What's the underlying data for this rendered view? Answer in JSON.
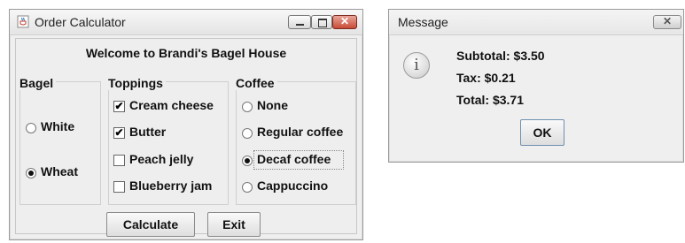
{
  "order_window": {
    "title": "Order Calculator",
    "welcome": "Welcome to Brandi's Bagel House",
    "bagel": {
      "label": "Bagel",
      "options": [
        {
          "label": "White",
          "selected": false
        },
        {
          "label": "Wheat",
          "selected": true
        }
      ]
    },
    "toppings": {
      "label": "Toppings",
      "options": [
        {
          "label": "Cream cheese",
          "checked": true
        },
        {
          "label": "Butter",
          "checked": true
        },
        {
          "label": "Peach jelly",
          "checked": false
        },
        {
          "label": "Blueberry jam",
          "checked": false
        }
      ]
    },
    "coffee": {
      "label": "Coffee",
      "options": [
        {
          "label": "None",
          "selected": false
        },
        {
          "label": "Regular coffee",
          "selected": false
        },
        {
          "label": "Decaf coffee",
          "selected": true
        },
        {
          "label": "Cappuccino",
          "selected": false
        }
      ]
    },
    "calculate_label": "Calculate",
    "exit_label": "Exit"
  },
  "message_window": {
    "title": "Message",
    "icon": "info-icon",
    "subtotal": "Subtotal: $3.50",
    "tax": "Tax: $0.21",
    "total": "Total: $3.71",
    "ok_label": "OK"
  },
  "check_glyph": "✔"
}
